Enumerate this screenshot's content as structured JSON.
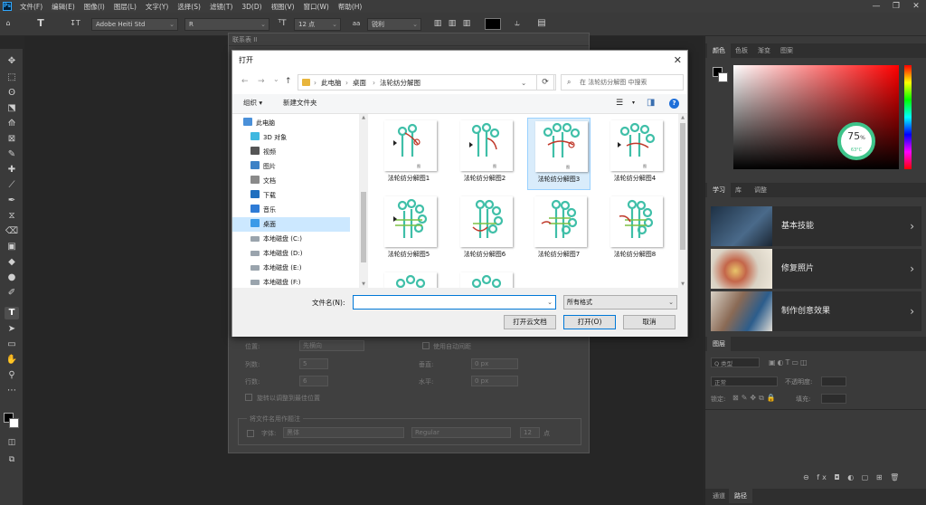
{
  "app": {
    "logo": "Ps"
  },
  "menu": [
    "文件(F)",
    "编辑(E)",
    "图像(I)",
    "图层(L)",
    "文字(Y)",
    "选择(S)",
    "滤镜(T)",
    "3D(D)",
    "视图(V)",
    "窗口(W)",
    "帮助(H)"
  ],
  "window_controls": {
    "minimize": "—",
    "restore": "❐",
    "close": "✕"
  },
  "options": {
    "font_family": "Adobe Heiti Std",
    "font_style": "R",
    "font_size": "12 点",
    "antialias": "锐利",
    "tool_glyph": "T",
    "tool_glyph2": "↧T"
  },
  "tools": [
    "✥",
    "⬚",
    "ʘ",
    "⬔",
    "⟰",
    "⊠",
    "✎",
    "✚",
    "⟋",
    "✒",
    "⧖",
    "⌫",
    "▣",
    "◆",
    "●",
    "✐",
    "T",
    "➤",
    "▭",
    "✋",
    "⚲",
    "⋯"
  ],
  "bg_dialog": {
    "title": "联系表 II",
    "position_label": "位置:",
    "position_value": "先横向",
    "auto_spacing": "使用自动间距",
    "columns_label": "列数:",
    "columns_value": "5",
    "vertical_label": "垂直:",
    "vertical_value": "0 px",
    "rows_label": "行数:",
    "rows_value": "6",
    "horizontal_label": "水平:",
    "horizontal_value": "0 px",
    "rotate": "旋转以调整到最佳位置",
    "caption_section": "将文件名用作题注",
    "font_label": "字体:",
    "font_value": "黑体",
    "font_style": "Regular",
    "font_size": "12",
    "font_unit": "点"
  },
  "open_dialog": {
    "title": "打开",
    "close": "✕",
    "nav": {
      "back": "←",
      "forward": "→",
      "dropdown": "⌄",
      "up": "↑"
    },
    "breadcrumb": [
      "此电脑",
      "桌面",
      "法轮纺分解图"
    ],
    "breadcrumb_sep": "›",
    "refresh": "⟳",
    "search_placeholder": "在 法轮纺分解图 中搜索",
    "organize": "组织 ▾",
    "new_folder": "新建文件夹",
    "view_glyph": "☰",
    "pane_glyph": "◨",
    "help": "?",
    "sidebar": [
      {
        "label": "此电脑",
        "color": "#4a90d9"
      },
      {
        "label": "3D 对象",
        "color": "#3fb8e0"
      },
      {
        "label": "视频",
        "color": "#555"
      },
      {
        "label": "图片",
        "color": "#3d82c6"
      },
      {
        "label": "文档",
        "color": "#8a8a8a"
      },
      {
        "label": "下载",
        "color": "#1f6fbf"
      },
      {
        "label": "音乐",
        "color": "#2e7bd6"
      },
      {
        "label": "桌面",
        "color": "#3a9ae8"
      },
      {
        "label": "本地磁盘 (C:)",
        "color": "#9aa4ad"
      },
      {
        "label": "本地磁盘 (D:)",
        "color": "#9aa4ad"
      },
      {
        "label": "本地磁盘 (E:)",
        "color": "#9aa4ad"
      },
      {
        "label": "本地磁盘 (F:)",
        "color": "#9aa4ad"
      }
    ],
    "files": [
      "法轮纺分解图1",
      "法轮纺分解图2",
      "法轮纺分解图3",
      "法轮纺分解图4",
      "法轮纺分解图5",
      "法轮纺分解图6",
      "法轮纺分解图7",
      "法轮纺分解图8",
      "",
      ""
    ],
    "filename_label": "文件名(N):",
    "filename_value": "",
    "filetype_value": "所有格式",
    "btn_cloud": "打开云文档",
    "btn_open": "打开(O)",
    "btn_cancel": "取消"
  },
  "right_panel": {
    "color_tabs": [
      "颜色",
      "色板",
      "渐变",
      "图案"
    ],
    "progress_value": "75",
    "progress_unit": "%",
    "progress_sub": "63°C",
    "learn_tabs": [
      "学习",
      "库",
      "调整"
    ],
    "learn_items": [
      "基本技能",
      "修复照片",
      "制作创意效果"
    ],
    "layers_tab": "图层",
    "kind_label": "Q 类型",
    "blend_value": "正常",
    "opacity_label": "不透明度:",
    "lock_label": "锁定:",
    "fill_label": "填充:",
    "bottom_tabs": [
      "通道",
      "路径"
    ],
    "footer_icons": "⊖ fx ◘ ◐ ▢ ⊞ 🗑"
  },
  "colors": {
    "accent_green": "#3ec48a",
    "teal": "#3fbfa8"
  }
}
